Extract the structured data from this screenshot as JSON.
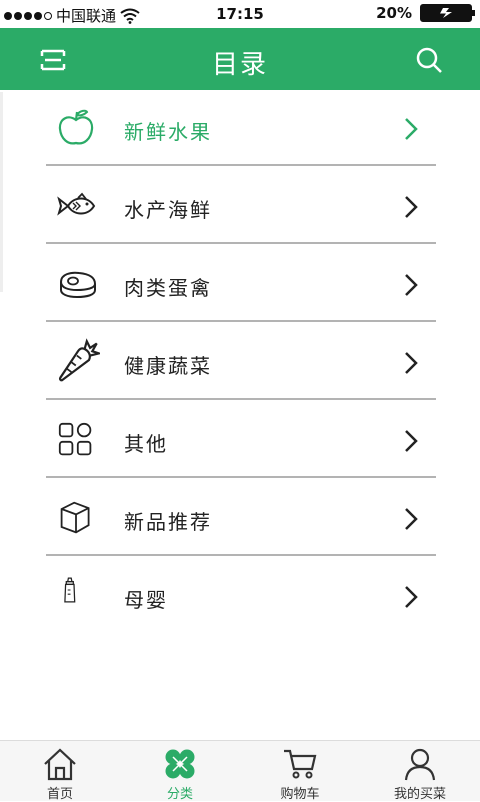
{
  "status_bar": {
    "carrier": "中国联通",
    "time": "17:15",
    "battery": "20%"
  },
  "header": {
    "title": "目录",
    "menu_icon": "menu-icon",
    "search_icon": "search-icon"
  },
  "categories": [
    {
      "label": "新鲜水果",
      "icon": "apple-icon",
      "active": true
    },
    {
      "label": "水产海鲜",
      "icon": "fish-icon",
      "active": false
    },
    {
      "label": "肉类蛋禽",
      "icon": "steak-icon",
      "active": false
    },
    {
      "label": "健康蔬菜",
      "icon": "carrot-icon",
      "active": false
    },
    {
      "label": "其他",
      "icon": "grid-icon",
      "active": false
    },
    {
      "label": "新品推荐",
      "icon": "box-icon",
      "active": false
    },
    {
      "label": "母婴",
      "icon": "baby-bottle-icon",
      "active": false
    }
  ],
  "tabbar": [
    {
      "label": "首页",
      "icon": "home-icon",
      "active": false
    },
    {
      "label": "分类",
      "icon": "clover-icon",
      "active": true
    },
    {
      "label": "购物车",
      "icon": "cart-icon",
      "active": false
    },
    {
      "label": "我的买菜",
      "icon": "user-icon",
      "active": false
    }
  ],
  "colors": {
    "accent": "#2bab67",
    "divider": "#b3b3b3"
  }
}
